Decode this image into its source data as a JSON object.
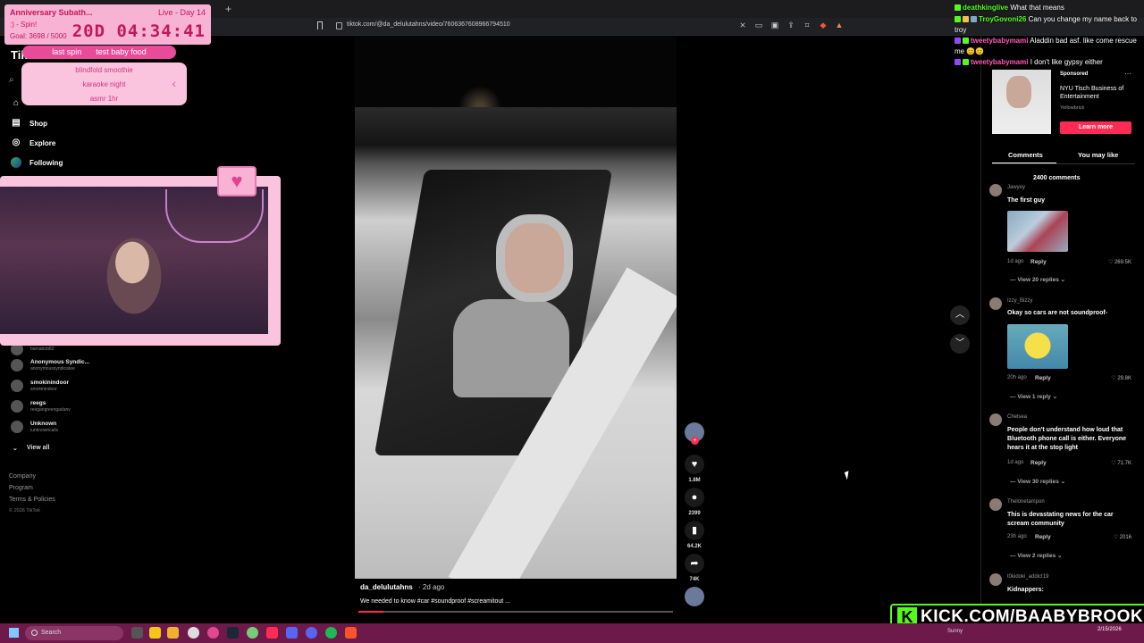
{
  "browser": {
    "url": "tiktok.com/@da_delulutahns/video/7606367608966794510",
    "new_tab": "+"
  },
  "sidebar": {
    "logo": "TikTok",
    "nav": [
      {
        "label": "Shop",
        "icon": "shop-icon"
      },
      {
        "label": "Explore",
        "icon": "explore-icon"
      },
      {
        "label": "Following",
        "icon": "following-avatar"
      }
    ],
    "accounts": [
      {
        "name": "",
        "handle": "bamabob82"
      },
      {
        "name": "Anonymous Syndic...",
        "handle": "anonymoussyndicatee"
      },
      {
        "name": "smokinindoor",
        "handle": "smokinindoor"
      },
      {
        "name": "reegs",
        "handle": "reegangreengadany"
      },
      {
        "name": "Unknown",
        "handle": "iunknowncallx"
      }
    ],
    "view_all": "View all",
    "footer": [
      "Company",
      "Program",
      "Terms & Policies"
    ],
    "copyright": "© 2026 TikTok"
  },
  "overlay": {
    "title": "Anniversary Subath...",
    "spin": ":) - Spin!",
    "goal": "Goal: 3698 / 5000",
    "live_day": "Live - Day 14",
    "timer": "20D 04:34:41",
    "last_spin_label": "last spin",
    "last_spin_value": "test baby food",
    "spin_options": [
      "blindfold smoothie",
      "karaoke night",
      "asmr 1hr"
    ]
  },
  "video": {
    "username": "da_delulutahns",
    "age": "· 2d ago",
    "caption": "We needed to know #car #soundproof #screamitout ...",
    "progress": 0.08,
    "likes": "1.8M",
    "comments": "2399",
    "saves": "64.2K",
    "shares": "74K"
  },
  "ad": {
    "sponsored": "Sponsored",
    "title": "NYU Tisch Business of Entertainment",
    "brand": "Yellowbrick",
    "button": "Learn more"
  },
  "tabs": {
    "comments": "Comments",
    "you_may_like": "You may like"
  },
  "comments_total": "2400 comments",
  "comments": [
    {
      "user": "Jawyey",
      "text": "The first guy",
      "age": "1d ago",
      "reply": "Reply",
      "likes": "269.5K",
      "view": "View 20 replies"
    },
    {
      "user": "Izzy_Bizzy",
      "text": "Okay so cars are not soundproof-",
      "age": "20h ago",
      "reply": "Reply",
      "likes": "29.8K",
      "view": "View 1 reply"
    },
    {
      "user": "Chelsea",
      "text": "People don't understand how loud that Bluetooth phone call is either. Everyone hears it at the stop light",
      "age": "1d ago",
      "reply": "Reply",
      "likes": "71.7K",
      "view": "View 30 replies"
    },
    {
      "user": "Thelonetampon",
      "text": "This is devastating news for the car scream community",
      "age": "23h ago",
      "reply": "Reply",
      "likes": "2016",
      "view": "View 2 replies"
    },
    {
      "user": "t0kidoki_addict19",
      "text": "Kidnappers:",
      "age": "",
      "reply": "",
      "likes": "",
      "view": ""
    }
  ],
  "chat": [
    {
      "user": "deathkinglive",
      "message": "What that means"
    },
    {
      "user": "TroyGovoni26",
      "message": "Can you change my name back to troy"
    },
    {
      "user": "tweetybabymami",
      "message": "Aladdin bad asf. like come rescue me 😊😊"
    },
    {
      "user": "tweetybabymami",
      "message": "I don't like gypsy either"
    }
  ],
  "kick_banner": "KICK.COM/BAABYBROOK",
  "taskbar": {
    "search": "Search",
    "weather": "Sunny",
    "date": "2/15/2026"
  },
  "colors": {
    "tiktok_red": "#fe2c55",
    "kick_green": "#53fc18",
    "overlay_pink": "#f8b3d4",
    "taskbar": "#6d1a4a"
  }
}
